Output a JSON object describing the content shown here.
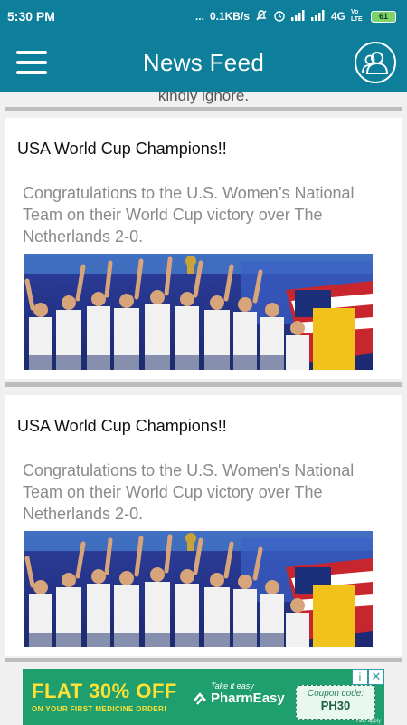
{
  "status_bar": {
    "time": "5:30 PM",
    "dots": "...",
    "speed": "0.1KB/s",
    "network": "4G",
    "volte": "Vo LTE",
    "battery": "61"
  },
  "app_bar": {
    "title": "News Feed",
    "menu_icon": "hamburger-menu-icon",
    "profile_icon": "users-icon"
  },
  "feed": {
    "partial_text": "kindly ignore.",
    "posts": [
      {
        "title": "USA World Cup Champions!!",
        "description": "Congratulations to the U.S. Women’s National Team on their World Cup victory over The Netherlands 2-0."
      },
      {
        "title": "USA World Cup Champions!!",
        "description": "Congratulations to the U.S. Women's National Team on their World Cup victory over The Netherlands 2-0."
      }
    ]
  },
  "ad": {
    "headline": "FLAT 30% OFF",
    "subline": "ON YOUR FIRST MEDICINE ORDER!",
    "tagline": "Take it easy",
    "brand": "PharmEasy",
    "coupon_label": "Coupon code:",
    "coupon_code": "PH30",
    "footnote": "T&C apply",
    "info_icon": "info-icon",
    "close_icon": "close-icon"
  },
  "colors": {
    "primary": "#0d7f9a",
    "ad_background": "#1f9e6e",
    "ad_text": "#ffe234"
  }
}
